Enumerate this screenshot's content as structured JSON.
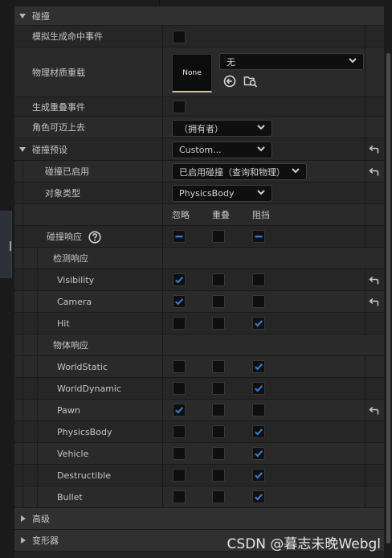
{
  "sections": {
    "collision": "碰撞",
    "advanced": "高级",
    "transform": "变形器"
  },
  "props": {
    "simulate_hit": "模拟生成命中事件",
    "phys_material": "物理材质重载",
    "gen_overlap": "生成重叠事件",
    "can_step_up": "角色可迈上去",
    "presets": "碰撞预设",
    "collision_enabled": "碰撞已启用",
    "object_type": "对象类型",
    "collision_responses": "碰撞响应",
    "trace_responses": "检测响应",
    "object_responses": "物体响应"
  },
  "values": {
    "material_none": "None",
    "material_combo": "无",
    "can_step_up": "（拥有者）",
    "presets": "Custom...",
    "collision_enabled": "已启用碰撞（查询和物理）",
    "object_type": "PhysicsBody"
  },
  "columns": {
    "ignore": "忽略",
    "overlap": "重叠",
    "block": "阻挡"
  },
  "checkbox_state": {
    "simulate_hit": false,
    "gen_overlap": false,
    "collision_responses": [
      "mixed",
      "off",
      "mixed"
    ]
  },
  "responses": [
    {
      "name": "Visibility",
      "ignore": true,
      "overlap": false,
      "block": false,
      "reset": true
    },
    {
      "name": "Camera",
      "ignore": true,
      "overlap": false,
      "block": false,
      "reset": true
    },
    {
      "name": "Hit",
      "ignore": false,
      "overlap": false,
      "block": true,
      "reset": false
    },
    {
      "name": "WorldStatic",
      "ignore": false,
      "overlap": false,
      "block": true,
      "reset": false
    },
    {
      "name": "WorldDynamic",
      "ignore": false,
      "overlap": false,
      "block": true,
      "reset": false
    },
    {
      "name": "Pawn",
      "ignore": true,
      "overlap": false,
      "block": false,
      "reset": true
    },
    {
      "name": "PhysicsBody",
      "ignore": false,
      "overlap": false,
      "block": true,
      "reset": false
    },
    {
      "name": "Vehicle",
      "ignore": false,
      "overlap": false,
      "block": true,
      "reset": false
    },
    {
      "name": "Destructible",
      "ignore": false,
      "overlap": false,
      "block": true,
      "reset": false
    },
    {
      "name": "Bullet",
      "ignore": false,
      "overlap": false,
      "block": true,
      "reset": false
    }
  ],
  "watermark": "CSDN @暮志未晚Webgl",
  "colors": {
    "check": "#2a7fd4",
    "panel": "#262626",
    "checkbox_bg": "#0f0f0f"
  },
  "icons": [
    "chevron-down-icon",
    "reset-arrow-icon",
    "help-icon",
    "use-selected-icon",
    "browse-icon"
  ]
}
